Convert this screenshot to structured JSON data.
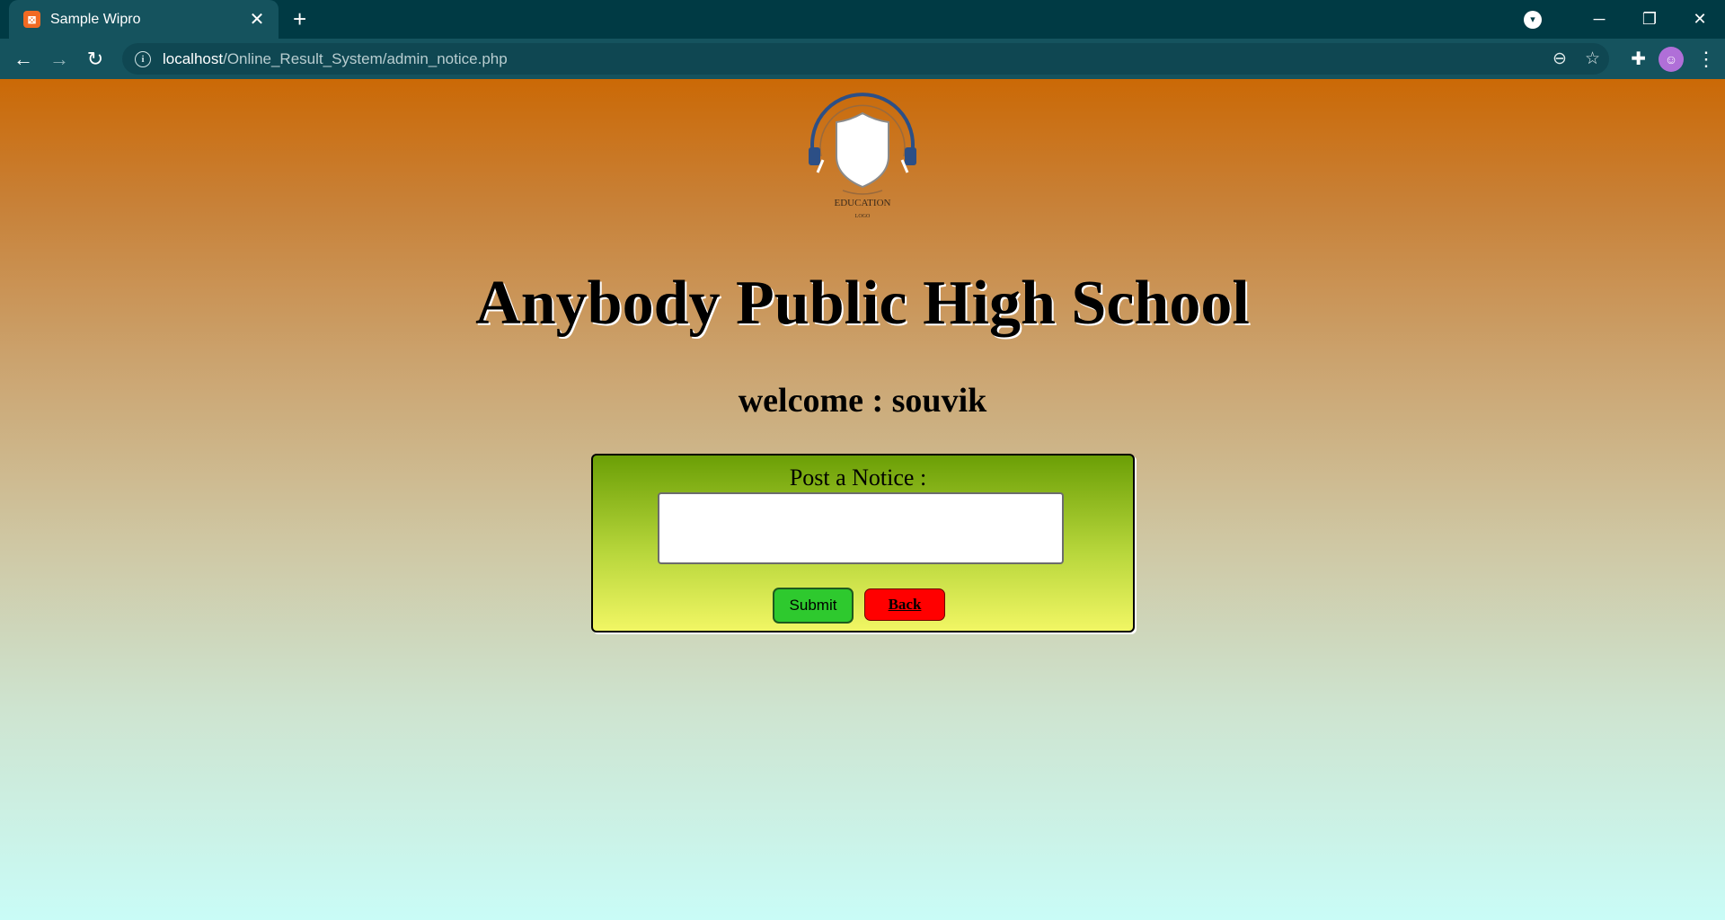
{
  "browser": {
    "tab_title": "Sample Wipro",
    "tab_favicon": "xampp-icon",
    "url_host": "localhost",
    "url_path": "/Online_Result_System/admin_notice.php"
  },
  "page": {
    "logo": {
      "line1": "EDUCATION",
      "line2": "LOGO"
    },
    "school_name": "Anybody Public High School",
    "welcome": "welcome : souvik",
    "notice_form": {
      "label": "Post a Notice :",
      "textarea_value": "",
      "submit_label": "Submit",
      "back_label": "Back"
    }
  },
  "colors": {
    "gradient_top": "#cb6906",
    "gradient_bottom": "#c9fcf7",
    "submit_button": "#2ec92e",
    "back_button": "#ff0000",
    "panel_top": "#6b9f06",
    "panel_bottom": "#f1f664"
  }
}
